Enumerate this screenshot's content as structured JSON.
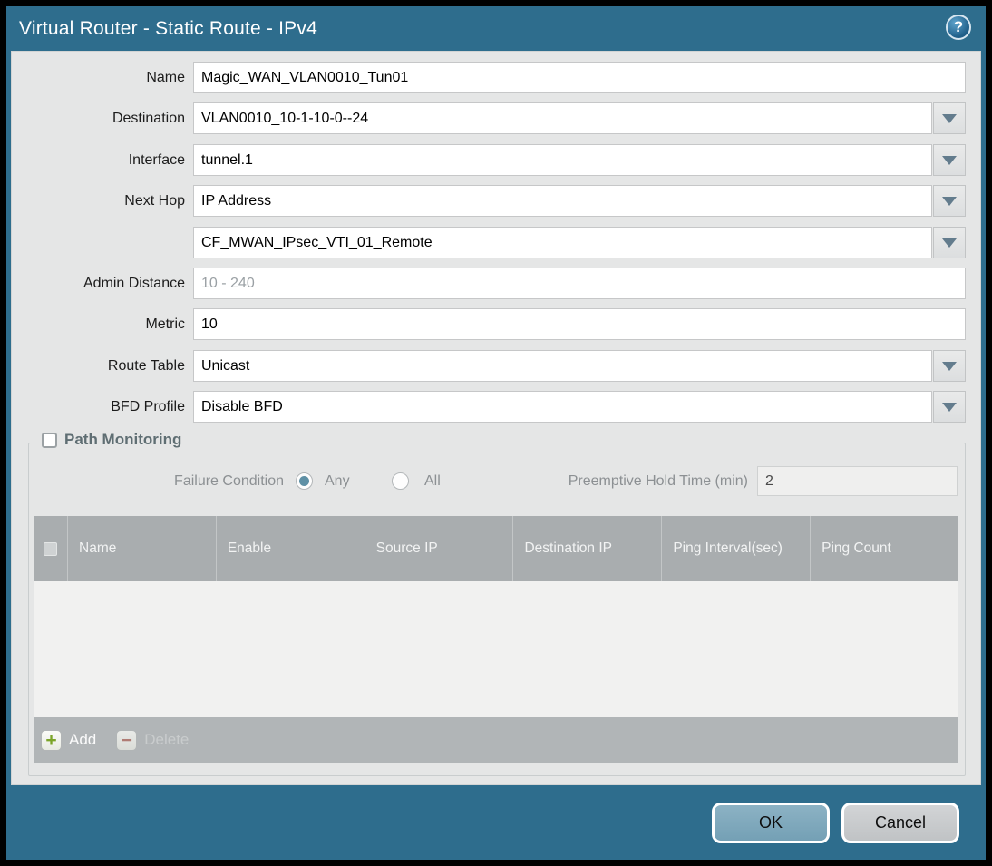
{
  "title_bar": {
    "title": "Virtual Router - Static Route - IPv4",
    "help_glyph": "?"
  },
  "form": {
    "rows": [
      {
        "label": "Name",
        "value": "Magic_WAN_VLAN0010_Tun01",
        "type": "text"
      },
      {
        "label": "Destination",
        "value": "VLAN0010_10-1-10-0--24",
        "type": "dropdown"
      },
      {
        "label": "Interface",
        "value": "tunnel.1",
        "type": "dropdown"
      },
      {
        "label": "Next Hop",
        "value": "IP Address",
        "type": "dropdown"
      },
      {
        "label": "",
        "value": "CF_MWAN_IPsec_VTI_01_Remote",
        "type": "dropdown"
      },
      {
        "label": "Admin Distance",
        "value": "",
        "placeholder": "10 - 240",
        "type": "text"
      },
      {
        "label": "Metric",
        "value": "10",
        "type": "text"
      },
      {
        "label": "Route Table",
        "value": "Unicast",
        "type": "dropdown"
      },
      {
        "label": "BFD Profile",
        "value": "Disable BFD",
        "type": "dropdown"
      }
    ]
  },
  "path_monitoring": {
    "section_label": "Path Monitoring",
    "checkbox_checked": false,
    "failure_condition": {
      "label": "Failure Condition",
      "options": [
        {
          "label": "Any",
          "selected": true
        },
        {
          "label": "All",
          "selected": false
        }
      ]
    },
    "preemptive_hold_time": {
      "label": "Preemptive Hold Time (min)",
      "value": "2"
    },
    "table": {
      "columns": [
        "Name",
        "Enable",
        "Source IP",
        "Destination IP",
        "Ping Interval(sec)",
        "Ping Count"
      ],
      "rows": []
    },
    "toolbar": {
      "add_label": "Add",
      "delete_label": "Delete",
      "add_glyph": "+",
      "delete_glyph": "−",
      "delete_enabled": false
    }
  },
  "footer": {
    "ok_label": "OK",
    "cancel_label": "Cancel"
  },
  "colors": {
    "titlebar_teal": "#2e6d8d",
    "panel_bg": "#e5e6e6",
    "table_header_bg": "#a9adaf",
    "table_toolbar_bg": "#b1b5b7",
    "ok_button": "#7fa9bc",
    "cancel_button": "#c9cbcd",
    "add_icon_green": "#7ba428",
    "delete_icon_red": "#b0695e",
    "radio_selected": "#5e90a5"
  }
}
